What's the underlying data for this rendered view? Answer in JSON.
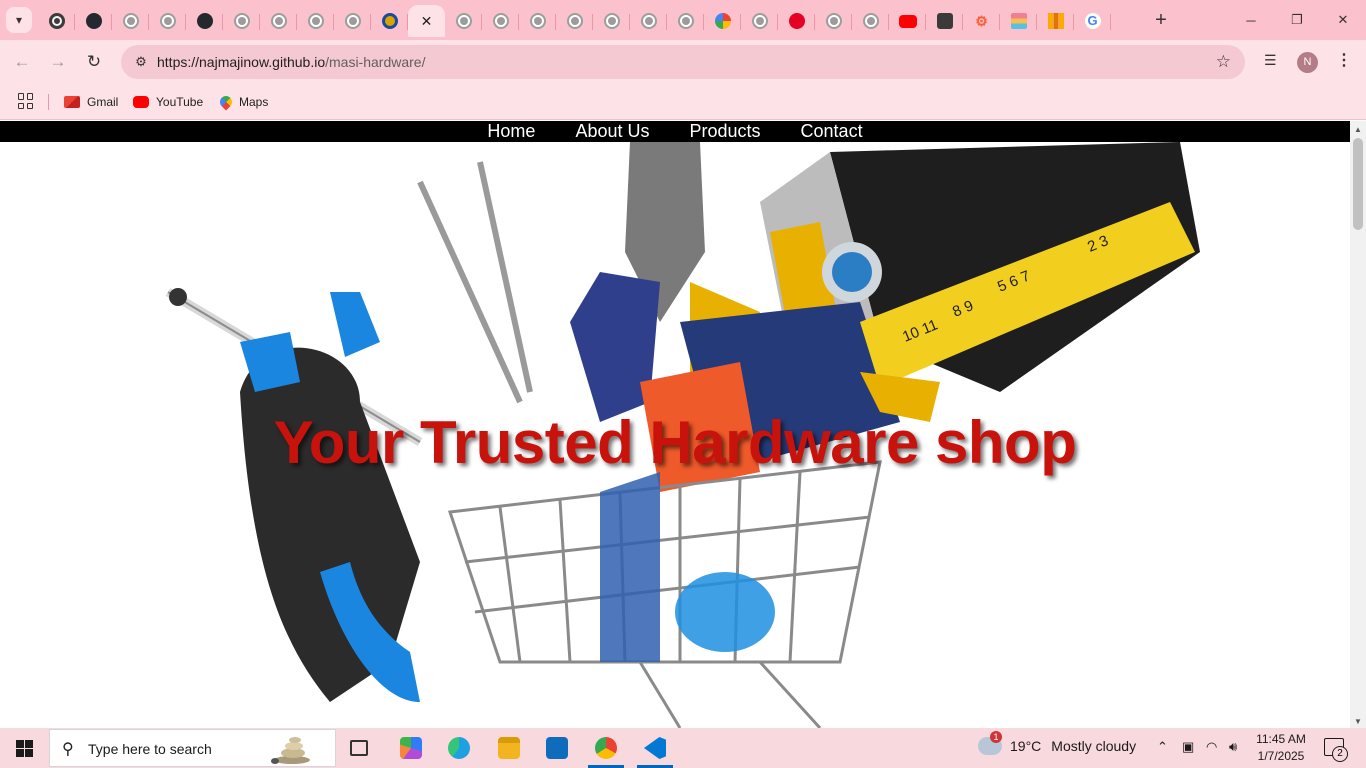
{
  "browser": {
    "tabs": [
      {
        "icon": "chatgpt-icon"
      },
      {
        "icon": "github-icon"
      },
      {
        "icon": "globe-icon"
      },
      {
        "icon": "globe-icon"
      },
      {
        "icon": "github-icon"
      },
      {
        "icon": "globe-icon"
      },
      {
        "icon": "globe-icon"
      },
      {
        "icon": "globe-icon"
      },
      {
        "icon": "globe-icon"
      },
      {
        "icon": "site-icon"
      },
      {
        "icon": "page-icon",
        "active": true
      },
      {
        "icon": "globe-icon"
      },
      {
        "icon": "globe-icon"
      },
      {
        "icon": "globe-icon"
      },
      {
        "icon": "globe-icon"
      },
      {
        "icon": "globe-icon"
      },
      {
        "icon": "globe-icon"
      },
      {
        "icon": "globe-icon"
      },
      {
        "icon": "google-photos-icon"
      },
      {
        "icon": "globe-icon"
      },
      {
        "icon": "pinterest-icon"
      },
      {
        "icon": "globe-icon"
      },
      {
        "icon": "globe-icon"
      },
      {
        "icon": "youtube-icon"
      },
      {
        "icon": "app-icon"
      },
      {
        "icon": "hubspot-icon"
      },
      {
        "icon": "rainbow-icon"
      },
      {
        "icon": "analytics-icon"
      },
      {
        "icon": "google-icon"
      }
    ],
    "address": {
      "host": "https://najmajinow.github.io",
      "path": "/masi-hardware/"
    },
    "profile_initial": "N",
    "bookmarks": [
      {
        "label": "Gmail",
        "icon": "gmail-icon"
      },
      {
        "label": "YouTube",
        "icon": "youtube-icon"
      },
      {
        "label": "Maps",
        "icon": "maps-icon"
      }
    ]
  },
  "site": {
    "nav": [
      "Home",
      "About Us",
      "Products",
      "Contact"
    ],
    "hero_title": "Your Trusted Hardware shop"
  },
  "taskbar": {
    "search_placeholder": "Type here to search",
    "weather_temp": "19°C",
    "weather_text": "Mostly cloudy",
    "weather_badge": "1",
    "time": "11:45 AM",
    "date": "1/7/2025",
    "notification_count": "2"
  },
  "colors": {
    "chrome_tabstrip": "#fbc1cc",
    "chrome_toolbar": "#fde3e8",
    "site_nav_bg": "#000000",
    "hero_title": "#c8120c",
    "taskbar": "#f8d9de"
  }
}
